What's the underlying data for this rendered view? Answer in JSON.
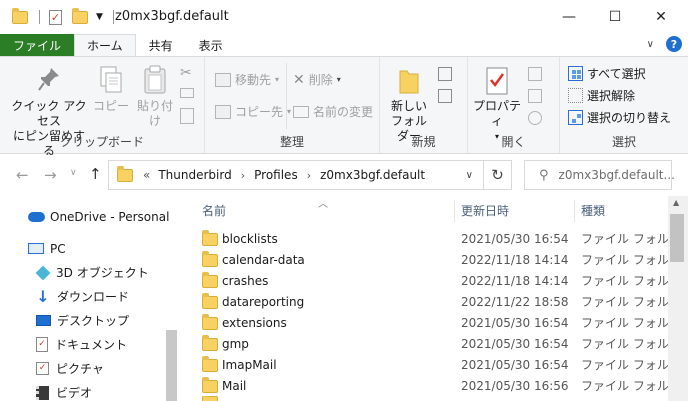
{
  "window": {
    "title": "z0mx3bgf.default",
    "minimize": "—",
    "maximize": "☐",
    "close": "✕"
  },
  "tabs": {
    "file": "ファイル",
    "home": "ホーム",
    "share": "共有",
    "view": "表示"
  },
  "ribbon": {
    "clipboard": {
      "label": "クリップボード",
      "pin_line1": "クイック アクセス",
      "pin_line2": "にピン留めする",
      "copy": "コピー",
      "paste": "貼り付け"
    },
    "organize": {
      "label": "整理",
      "move_to": "移動先",
      "copy_to": "コピー先",
      "delete": "削除",
      "rename": "名前の変更"
    },
    "new": {
      "label": "新規",
      "new_folder_line1": "新しい",
      "new_folder_line2": "フォルダー"
    },
    "open": {
      "label": "開く",
      "properties": "プロパティ"
    },
    "select": {
      "label": "選択",
      "select_all": "すべて選択",
      "select_none": "選択解除",
      "invert": "選択の切り替え"
    }
  },
  "address": {
    "overflow": "«",
    "crumbs": [
      "Thunderbird",
      "Profiles",
      "z0mx3bgf.default"
    ],
    "search_placeholder": "z0mx3bgf.default..."
  },
  "nav": {
    "items": [
      {
        "label": "OneDrive - Personal",
        "icon": "cloud-icon"
      },
      {
        "label": "PC",
        "icon": "pc-icon"
      },
      {
        "label": "3D オブジェクト",
        "icon": "3d-objects-icon"
      },
      {
        "label": "ダウンロード",
        "icon": "download-icon"
      },
      {
        "label": "デスクトップ",
        "icon": "desktop-icon"
      },
      {
        "label": "ドキュメント",
        "icon": "documents-icon"
      },
      {
        "label": "ピクチャ",
        "icon": "pictures-icon"
      },
      {
        "label": "ビデオ",
        "icon": "video-icon"
      }
    ]
  },
  "columns": {
    "name": "名前",
    "date": "更新日時",
    "type": "種類"
  },
  "files": [
    {
      "name": "blocklists",
      "date": "2021/05/30 16:54",
      "type": "ファイル フォルダー"
    },
    {
      "name": "calendar-data",
      "date": "2022/11/18 14:14",
      "type": "ファイル フォルダー"
    },
    {
      "name": "crashes",
      "date": "2022/11/18 14:14",
      "type": "ファイル フォルダー"
    },
    {
      "name": "datareporting",
      "date": "2022/11/22 18:58",
      "type": "ファイル フォルダー"
    },
    {
      "name": "extensions",
      "date": "2021/05/30 16:54",
      "type": "ファイル フォルダー"
    },
    {
      "name": "gmp",
      "date": "2021/05/30 16:54",
      "type": "ファイル フォルダー"
    },
    {
      "name": "ImapMail",
      "date": "2021/05/30 16:54",
      "type": "ファイル フォルダー"
    },
    {
      "name": "Mail",
      "date": "2021/05/30 16:56",
      "type": "ファイル フォルダー"
    }
  ]
}
